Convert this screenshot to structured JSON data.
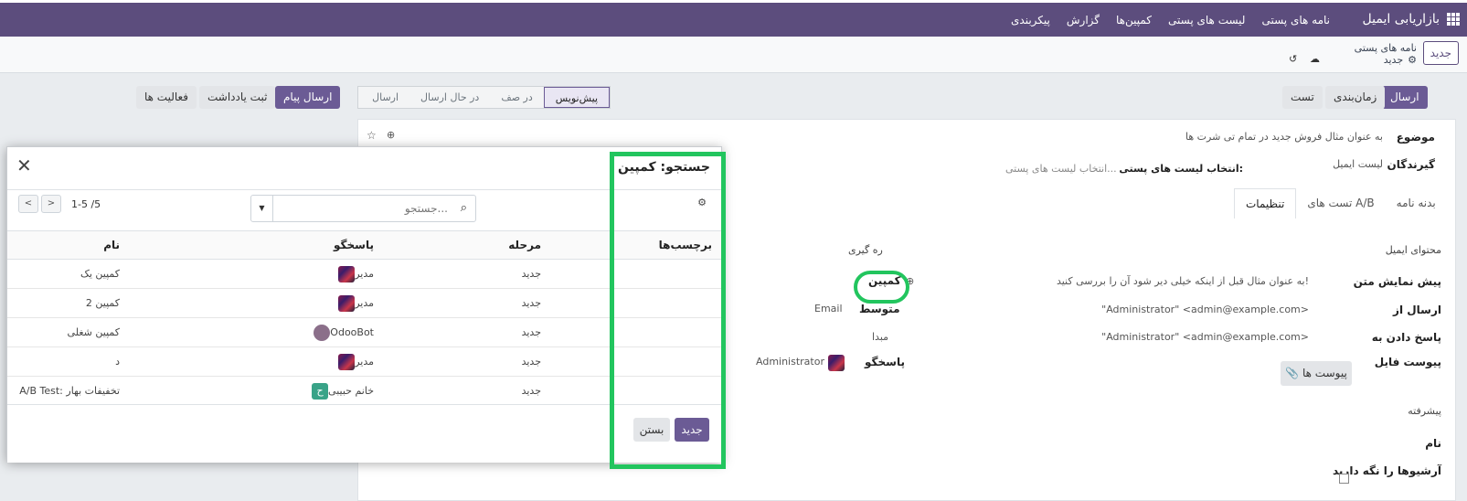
{
  "topbar": {
    "brand": "بازاریابی ایمیل",
    "nav": [
      "نامه های پستی",
      "لیست های پستی",
      "کمپین‌ها",
      "گزارش",
      "پیکربندی"
    ]
  },
  "control": {
    "new_label": "جدید",
    "breadcrumb_parent": "نامه های پستی",
    "breadcrumb_current": "جدید"
  },
  "statusbar": {
    "send": "ارسال",
    "schedule": "زمان‌بندی",
    "test": "تست",
    "stages": [
      "پیش‌نویس",
      "در صف",
      "در حال ارسال",
      "ارسال"
    ],
    "send_message": "ارسال پیام",
    "log_note": "ثبت یادداشت",
    "activities": "فعالیت ها"
  },
  "form": {
    "subject_label": "موضوع",
    "subject_value": "به عنوان مثال فروش جدید در تمام تی شرت ها",
    "recipients_label": "گیرندگان",
    "recipients_value": "لیست ایمیل",
    "mailing_lists_label": "انتخاب لیست های پستی:",
    "mailing_lists_placeholder": "انتخاب لیست های پستی...",
    "tabs": [
      "بدنه نامه",
      "تست های A/B",
      "تنظیمات"
    ],
    "email_content_section": "محتوای ایمیل",
    "tracking_section": "ره گیری",
    "preview_label": "پیش نمایش متن",
    "preview_value": "به عنوان مثال قبل از اینکه خیلی دیر شود آن را بررسی کنید!",
    "from_label": "ارسال از",
    "from_value": "\"Administrator\" <admin@example.com>",
    "reply_label": "پاسخ دادن به",
    "reply_value": "\"Administrator\" <admin@example.com>",
    "attach_label": "پیوست فایل",
    "attach_button": "پیوست ها",
    "campaign_label": "کمپین",
    "medium_label": "متوسط",
    "medium_value": "Email",
    "source_label": "مبدا",
    "responsible_label": "پاسخگو",
    "responsible_value": "Administrator",
    "advanced_section": "پیشرفته",
    "name_label": "نام",
    "keep_archives_label": "آرشیوها را نگه دارید"
  },
  "modal": {
    "title": "جستجو: کمپین",
    "search_placeholder": "جستجو...",
    "pager_text": "1-5 /5",
    "columns": [
      "نام",
      "پاسخگو",
      "مرحله",
      "برچسب‌ها"
    ],
    "rows": [
      {
        "name": "کمپین یک",
        "responsible": "مدیر",
        "avatar": "img",
        "stage": "جدید",
        "tags": ""
      },
      {
        "name": "کمپین 2",
        "responsible": "مدیر",
        "avatar": "img",
        "stage": "جدید",
        "tags": ""
      },
      {
        "name": "کمپین شغلی",
        "responsible": "OdooBot",
        "avatar": "bot",
        "stage": "جدید",
        "tags": ""
      },
      {
        "name": "د",
        "responsible": "مدیر",
        "avatar": "img",
        "stage": "جدید",
        "tags": ""
      },
      {
        "name": "A/B Test: تخفیفات بهار",
        "responsible": "خانم حبیبی",
        "avatar": "letter",
        "avatar_letter": "ح",
        "stage": "جدید",
        "tags": ""
      }
    ],
    "new_button": "جدید",
    "close_button": "بستن"
  },
  "colors": {
    "brand": "#5c4d7d",
    "primary": "#6b5b95",
    "highlight": "#22c55e"
  }
}
